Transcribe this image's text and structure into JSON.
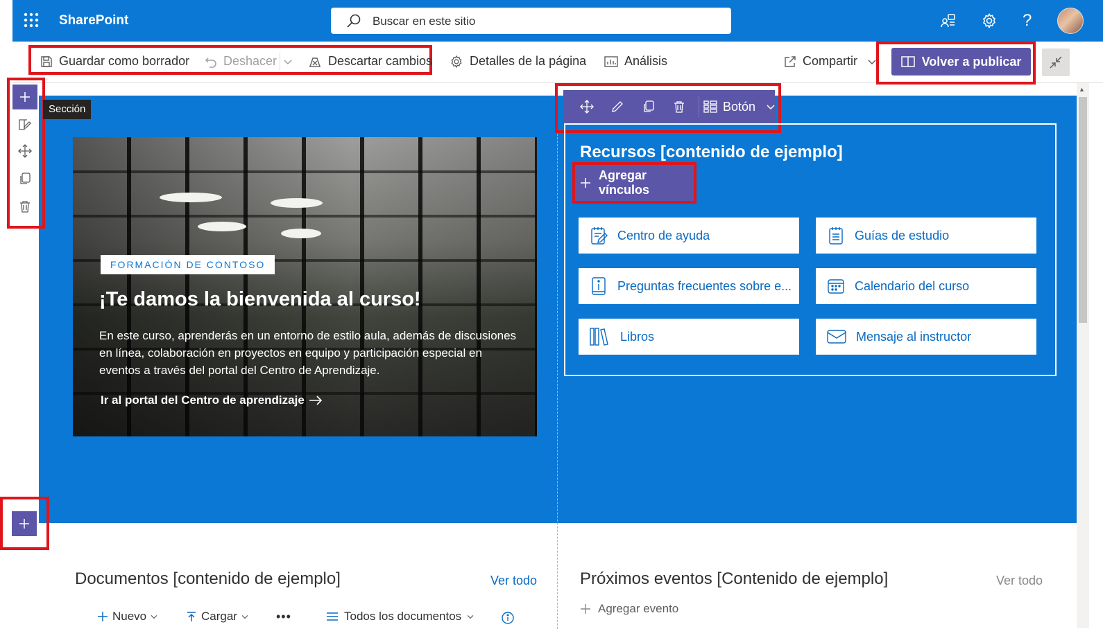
{
  "suite": {
    "app_name": "SharePoint",
    "search_placeholder": "Buscar en este sitio"
  },
  "command_bar": {
    "save_draft": "Guardar como borrador",
    "undo": "Deshacer",
    "discard": "Descartar cambios",
    "page_details": "Detalles de la página",
    "analytics": "Análisis",
    "share": "Compartir",
    "republish": "Volver a publicar"
  },
  "section_tooltip": "Sección",
  "hero": {
    "tag": "FORMACIÓN DE CONTOSO",
    "title": "¡Te damos la bienvenida al curso!",
    "body": "En este curso, aprenderás en un entorno de estilo aula, además de discusiones en línea, colaboración en proyectos en equipo y participación especial en eventos a través del portal del Centro de Aprendizaje.",
    "link": "Ir al portal del Centro de aprendizaje"
  },
  "webpart_toolbar": {
    "button_label": "Botón"
  },
  "resources": {
    "title": "Recursos [contenido de ejemplo]",
    "add_links": "Agregar vínculos",
    "links": [
      {
        "label": "Centro de ayuda",
        "icon": "notebook-edit-icon"
      },
      {
        "label": "Guías de estudio",
        "icon": "notebook-list-icon"
      },
      {
        "label": "Preguntas frecuentes sobre e...",
        "icon": "info-document-icon"
      },
      {
        "label": "Calendario del curso",
        "icon": "calendar-icon"
      },
      {
        "label": "Libros",
        "icon": "library-icon"
      },
      {
        "label": "Mensaje al instructor",
        "icon": "mail-icon"
      }
    ]
  },
  "documents": {
    "title": "Documentos [contenido de ejemplo]",
    "see_all": "Ver todo",
    "new": "Nuevo",
    "upload": "Cargar",
    "all_docs": "Todos los documentos"
  },
  "events": {
    "title": "Próximos eventos [Contenido de ejemplo]",
    "see_all": "Ver todo",
    "add_event": "Agregar evento"
  },
  "colors": {
    "brand_blue": "#0a78d4",
    "purple": "#5c56a8",
    "highlight_red": "#e0151c"
  }
}
